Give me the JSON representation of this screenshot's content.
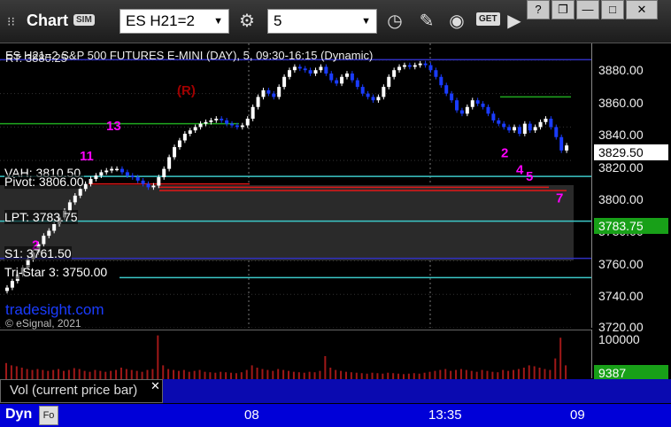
{
  "window": {
    "title": "Chart",
    "sim_badge": "SIM",
    "symbol": "ES H21=2",
    "interval": "5",
    "get_badge": "GET",
    "controls": [
      "?",
      "❐",
      "—",
      "□",
      "✕"
    ]
  },
  "chart": {
    "title": "ES H21=2  S&P 500 FUTURES E-MINI (DAY), 5, 09:30-16:15 (Dynamic)",
    "rt_label": "RT: 3880.25",
    "annotation_r": "(R)",
    "watermark": "tradesight.com",
    "copyright": "© eSignal, 2021",
    "level_labels": {
      "vah": "VAH: 3810.50",
      "pivot": "Pivot: 3806.00",
      "lpt": "LPT: 3783.75",
      "s1": "S1: 3761.50",
      "tristar": "Tri-Star 3: 3750.00"
    },
    "price_axis": [
      "3880.00",
      "3860.00",
      "3840.00",
      "3820.00",
      "3800.00",
      "3780.00",
      "3760.00",
      "3740.00",
      "3720.00"
    ],
    "last_price": "3829.50",
    "lpt_tag": "3783.75",
    "vol_axis": "100000",
    "vol_tag": "9387",
    "vol_legend": "Vol (current price bar)",
    "vol_close": "✕",
    "dyn_label": "Dyn",
    "time_labels": [
      "08",
      "13:35",
      "09"
    ],
    "colors": {
      "up": "#ffffff",
      "down": "#1a3cff",
      "green_level": "#1fa81f",
      "red_level": "#e01818",
      "cyan_level": "#3cc8c8",
      "navy_level": "#3030c0",
      "magenta": "#ff00ff",
      "last_price_bg": "#ffffff",
      "lpt_bg": "#18a018",
      "vol_tag_bg": "#18a018"
    }
  },
  "chart_data": {
    "type": "candlestick",
    "ylim": [
      3720,
      3890
    ],
    "price_series": [
      3744,
      3748,
      3752,
      3756,
      3761,
      3765,
      3770,
      3775,
      3778,
      3782,
      3786,
      3790,
      3795,
      3799,
      3803,
      3806,
      3809,
      3811,
      3813,
      3814,
      3815,
      3815,
      3813,
      3811,
      3810,
      3808,
      3806,
      3804,
      3805,
      3810,
      3815,
      3822,
      3828,
      3832,
      3836,
      3838,
      3840,
      3842,
      3843,
      3844,
      3845,
      3844,
      3842,
      3841,
      3840,
      3841,
      3845,
      3852,
      3858,
      3862,
      3860,
      3858,
      3864,
      3870,
      3874,
      3876,
      3875,
      3874,
      3872,
      3874,
      3876,
      3872,
      3868,
      3866,
      3870,
      3872,
      3868,
      3864,
      3860,
      3858,
      3856,
      3858,
      3864,
      3870,
      3874,
      3876,
      3877,
      3876,
      3877,
      3878,
      3877,
      3874,
      3870,
      3865,
      3860,
      3856,
      3850,
      3848,
      3852,
      3856,
      3854,
      3852,
      3848,
      3844,
      3842,
      3840,
      3838,
      3840,
      3836,
      3842,
      3838,
      3840,
      3843,
      3845,
      3840,
      3834,
      3826,
      3829
    ],
    "volume": [
      0.35,
      0.3,
      0.28,
      0.25,
      0.22,
      0.2,
      0.22,
      0.2,
      0.18,
      0.2,
      0.22,
      0.18,
      0.2,
      0.24,
      0.22,
      0.18,
      0.16,
      0.2,
      0.18,
      0.16,
      0.18,
      0.2,
      0.25,
      0.22,
      0.2,
      0.18,
      0.16,
      0.2,
      0.22,
      0.95,
      0.3,
      0.22,
      0.2,
      0.18,
      0.2,
      0.16,
      0.18,
      0.2,
      0.16,
      0.15,
      0.14,
      0.16,
      0.15,
      0.14,
      0.13,
      0.15,
      0.2,
      0.3,
      0.25,
      0.22,
      0.2,
      0.18,
      0.22,
      0.2,
      0.18,
      0.16,
      0.15,
      0.14,
      0.16,
      0.15,
      0.18,
      0.5,
      0.25,
      0.2,
      0.18,
      0.16,
      0.15,
      0.14,
      0.13,
      0.12,
      0.14,
      0.13,
      0.12,
      0.14,
      0.13,
      0.12,
      0.11,
      0.12,
      0.13,
      0.12,
      0.14,
      0.16,
      0.18,
      0.2,
      0.22,
      0.18,
      0.2,
      0.22,
      0.2,
      0.18,
      0.16,
      0.2,
      0.18,
      0.16,
      0.15,
      0.2,
      0.18,
      0.2,
      0.22,
      0.25,
      0.3,
      0.28,
      0.25,
      0.22,
      0.2,
      0.45,
      0.9,
      0.3
    ],
    "levels": [
      {
        "name": "RT",
        "value": 3880.25
      },
      {
        "name": "VAH",
        "value": 3810.5
      },
      {
        "name": "Pivot",
        "value": 3806.0
      },
      {
        "name": "LPT",
        "value": 3783.75
      },
      {
        "name": "S1",
        "value": 3761.5
      },
      {
        "name": "Tri-Star 3",
        "value": 3750.0
      }
    ]
  }
}
